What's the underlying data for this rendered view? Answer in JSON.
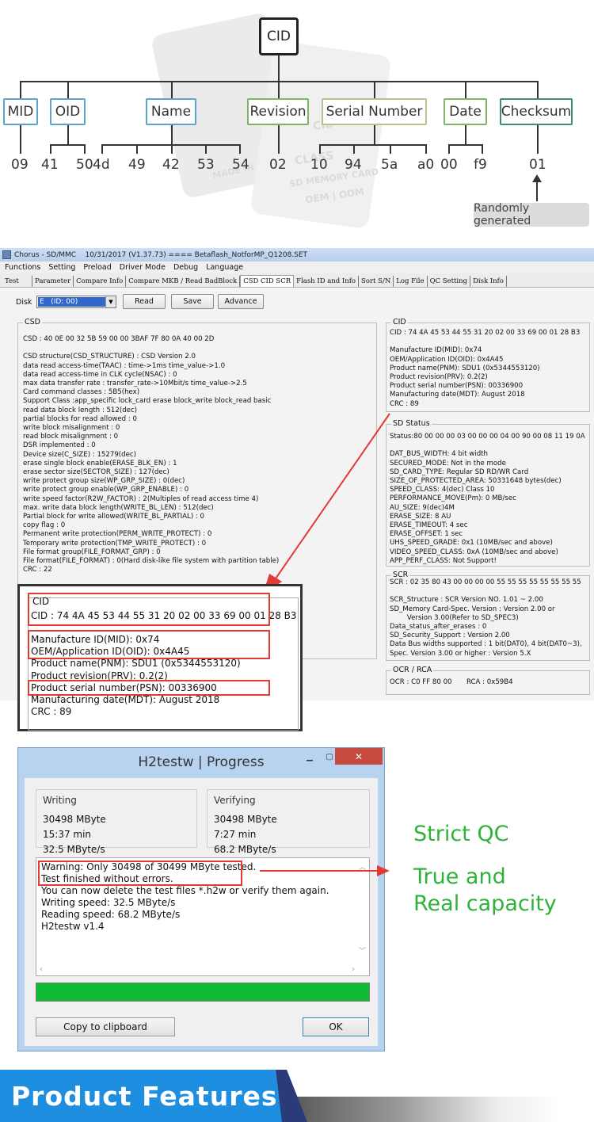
{
  "cid_diagram": {
    "root_label": "CID",
    "fields": [
      {
        "label": "MID"
      },
      {
        "label": "OID"
      },
      {
        "label": "Name"
      },
      {
        "label": "Revision"
      },
      {
        "label": "Serial Number"
      },
      {
        "label": "Date"
      },
      {
        "label": "Checksum"
      }
    ],
    "bytes": [
      "09",
      "41",
      "50",
      "4d",
      "49",
      "42",
      "53",
      "54",
      "02",
      "10",
      "94",
      "5a",
      "a0",
      "00",
      "f9",
      "01"
    ],
    "checksum_note": "Randomly generated",
    "watermark_lines": [
      "CID",
      "CLASS",
      "SD MEMORY CARD",
      "OEM | ODM",
      "MADE IN"
    ]
  },
  "chorus": {
    "title": "Chorus - SD/MMC    10/31/2017 (V1.37.73) ==== Betaflash_NotforMP_Q1208.SET",
    "menu": [
      "Functions",
      "Setting",
      "Preload",
      "Driver Mode",
      "Debug",
      "Language"
    ],
    "tabs": [
      "Test",
      "Parameter",
      "Compare Info",
      "Compare MKB / Read BadBlock",
      "CSD CID SCR",
      "Flash ID and Info",
      "Sort S/N",
      "Log File",
      "QC Setting",
      "Disk Info"
    ],
    "disk_label": "Disk",
    "disk_value": "E   (ID: 00)",
    "buttons": {
      "read": "Read",
      "save": "Save",
      "advance": "Advance"
    },
    "csd": {
      "title": "CSD",
      "lines": [
        "CSD : 40 0E 00 32 5B 59 00 00 3BAF 7F 80 0A 40 00 2D",
        "",
        "CSD structure(CSD_STRUCTURE) : CSD Version 2.0",
        "data read access-time(TAAC) : time->1ms time_value->1.0",
        "data read access-time in CLK cycle(NSAC) : 0",
        "max data transfer rate : transfer_rate->10Mbit/s time_value->2.5",
        "Card command classes : 5B5(hex)",
        "Support Class :app_specific lock_card erase block_write block_read basic",
        "read data block length : 512(dec)",
        "partial blocks for read allowed : 0",
        "write block misalignment : 0",
        "read block misalignment : 0",
        "DSR implemented : 0",
        "Device size(C_SIZE) : 15279(dec)",
        "erase single block enable(ERASE_BLK_EN) : 1",
        "erase sector size(SECTOR_SIZE) : 127(dec)",
        "write protect group size(WP_GRP_SIZE) : 0(dec)",
        "write protect group enable(WP_GRP_ENABLE) : 0",
        "write speed factor(R2W_FACTOR) : 2(Multiples of read access time 4)",
        "max. write data block length(WRITE_BL_LEN) : 512(dec)",
        "Partial block for write allowed(WRITE_BL_PARTIAL) : 0",
        "copy flag : 0",
        "Permanent write protection(PERM_WRITE_PROTECT) : 0",
        "Temporary write protection(TMP_WRITE_PROTECT) : 0",
        "File format group(FILE_FORMAT_GRP) : 0",
        "File format(FILE_FORMAT) : 0(Hard disk-like file system with partition table)",
        "CRC : 22"
      ]
    },
    "cid": {
      "title": "CID",
      "lines": [
        "CID : 74 4A 45 53 44 55 31 20 02 00 33 69 00 01 28 B3",
        "",
        "Manufacture ID(MID): 0x74",
        "OEM/Application ID(OID): 0x4A45",
        "Product name(PNM): SDU1 (0x5344553120)",
        "Product revision(PRV): 0.2(2)",
        "Product serial number(PSN): 00336900",
        "Manufacturing date(MDT): August 2018",
        "CRC : 89"
      ]
    },
    "sd_status": {
      "title": "SD Status",
      "lines": [
        "Status:80 00 00 00 03 00 00 00 04 00 90 00 08 11 19 0A",
        "",
        "DAT_BUS_WIDTH: 4 bit width",
        "SECURED_MODE: Not in the mode",
        "SD_CARD_TYPE: Regular SD RD/WR Card",
        "SIZE_OF_PROTECTED_AREA: 50331648 bytes(dec)",
        "SPEED_CLASS: 4(dec) Class 10",
        "PERFORMANCE_MOVE(Pm): 0 MB/sec",
        "AU_SIZE: 9(dec)4M",
        "ERASE_SIZE: 8 AU",
        "ERASE_TIMEOUT: 4 sec",
        "ERASE_OFFSET: 1 sec",
        "UHS_SPEED_GRADE: 0x1 (10MB/sec and above)",
        "VIDEO_SPEED_CLASS: 0xA (10MB/sec and above)",
        "APP_PERF_CLASS: Not Support!"
      ]
    },
    "scr": {
      "title": "SCR",
      "lines": [
        "SCR : 02 35 80 43 00 00 00 00 55 55 55 55 55 55 55 55",
        "",
        "SCR_Structure : SCR Version NO. 1.01 ~ 2.00",
        "SD_Memory Card-Spec. Version : Version 2.00 or",
        "        Version 3.00(Refer to SD_SPEC3)",
        "Data_status_after_erases : 0",
        "SD_Security_Support : Version 2.00",
        "Data Bus widths supported : 1 bit(DAT0), 4 bit(DAT0~3),",
        "Spec. Version 3.00 or higher : Version 5.X"
      ]
    },
    "ocr_rca": {
      "title": "OCR / RCA",
      "ocr": "OCR : C0 FF 80 00",
      "rca": "RCA : 0x59B4"
    }
  },
  "zoom": {
    "title": "CID",
    "cid_line": "CID : 74 4A 45 53 44 55 31 20 02 00 33 69 00 01 28 B3",
    "lines": [
      "Manufacture ID(MID): 0x74",
      "OEM/Application ID(OID): 0x4A45",
      "Product name(PNM): SDU1 (0x5344553120)",
      "Product revision(PRV): 0.2(2)",
      "Product serial number(PSN): 00336900",
      "Manufacturing date(MDT): August 2018",
      "CRC : 89"
    ]
  },
  "h2testw": {
    "title": "H2testw | Progress",
    "close_label": "✕",
    "writing": {
      "title": "Writing",
      "size": "30498 MByte",
      "time": "15:37 min",
      "speed": "32.5 MByte/s"
    },
    "verifying": {
      "title": "Verifying",
      "size": "30498 MByte",
      "time": "7:27 min",
      "speed": "68.2 MByte/s"
    },
    "log_lines": [
      "Warning: Only 30498 of 30499 MByte tested.",
      "Test finished without errors.",
      "You can now delete the test files *.h2w or verify them again.",
      "Writing speed: 32.5 MByte/s",
      "Reading speed: 68.2 MByte/s",
      "H2testw v1.4"
    ],
    "progress": 1.0,
    "copy_button": "Copy to clipboard",
    "ok_button": "OK"
  },
  "qc_text": {
    "line1": "Strict QC",
    "line2": "True and\nReal capacity"
  },
  "banner": {
    "title": "Product Features"
  },
  "colors": {
    "highlight_red": "#e53935",
    "qc_green": "#2db339",
    "progress_green": "#0fbb32",
    "banner_blue": "#1e8fe0"
  }
}
